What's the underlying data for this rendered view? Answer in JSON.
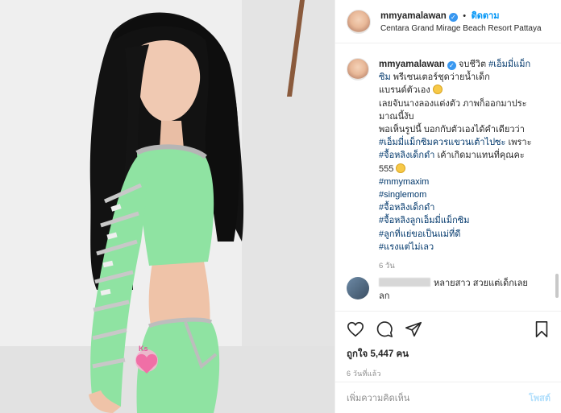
{
  "header": {
    "username": "mmyamalawan",
    "verified_icon": "verified-badge-icon",
    "separator": "•",
    "follow_label": "ติดตาม",
    "location": "Centara Grand Mirage Beach Resort Pattaya"
  },
  "caption": {
    "username": "mmyamalawan",
    "lines": [
      {
        "parts": [
          {
            "t": "text",
            "v": "จบชีวิต "
          },
          {
            "t": "tag",
            "v": "#เอ็มมี่แม็ก"
          }
        ]
      },
      {
        "parts": [
          {
            "t": "tag",
            "v": "ซิม"
          },
          {
            "t": "text",
            "v": " พรีเซนเตอร์ชุดว่ายน้ำเด็ก"
          }
        ]
      },
      {
        "parts": [
          {
            "t": "text",
            "v": "แบรนด์ตัวเอง "
          },
          {
            "t": "emoji",
            "v": "grin-emoji"
          }
        ]
      },
      {
        "parts": [
          {
            "t": "text",
            "v": "เลยจับนางลองแต่งตัว ภาพก็ออกมาประ"
          }
        ]
      },
      {
        "parts": [
          {
            "t": "text",
            "v": "มาณนี้งับ"
          }
        ]
      },
      {
        "parts": [
          {
            "t": "text",
            "v": "พอเห็นรูปนี้ บอกกับตัวเองได้คำเดียวว่า"
          }
        ]
      },
      {
        "parts": [
          {
            "t": "tag",
            "v": "#เอ็มมี่แม็กซิมควรแขวนเต้าไปซะ"
          },
          {
            "t": "text",
            "v": " เพราะ"
          }
        ]
      },
      {
        "parts": [
          {
            "t": "tag",
            "v": "#จื้อหลิงเด็กดำ"
          },
          {
            "t": "text",
            "v": " เค้าเกิดมาแทนที่คุณคะ"
          }
        ]
      },
      {
        "parts": [
          {
            "t": "text",
            "v": "555 "
          },
          {
            "t": "emoji",
            "v": "grin-emoji"
          }
        ]
      },
      {
        "parts": [
          {
            "t": "tag",
            "v": "#mmymaxim"
          }
        ]
      },
      {
        "parts": [
          {
            "t": "tag",
            "v": "#singlemom"
          }
        ]
      },
      {
        "parts": [
          {
            "t": "tag",
            "v": "#จื้อหลิงเด็กดำ"
          }
        ]
      },
      {
        "parts": [
          {
            "t": "tag",
            "v": "#จื้อหลิงลูกเอ็มมี่แม็กซิม"
          }
        ]
      },
      {
        "parts": [
          {
            "t": "tag",
            "v": "#ลูกที่แย่ขอเป็นแม่ที่ดี"
          }
        ]
      },
      {
        "parts": [
          {
            "t": "tag",
            "v": "#แรงแต่ไม่เลว"
          }
        ]
      }
    ],
    "time": "6 วัน"
  },
  "comment": {
    "text_line1": "หลายสาว สวยแต่เด็กเลย",
    "text_line2": "ลก"
  },
  "actions": {
    "like_icon": "heart-icon",
    "comment_icon": "comment-icon",
    "share_icon": "share-icon",
    "save_icon": "bookmark-icon",
    "likes_text": "ถูกใจ 5,447 คน",
    "post_time": "6 วันที่แล้ว"
  },
  "add_comment": {
    "placeholder": "เพิ่มความคิดเห็น",
    "post_label": "โพสต์"
  },
  "photo": {
    "sticker_text": "Ks"
  },
  "colors": {
    "link": "#00376b",
    "accent": "#0095f6",
    "muted": "#8e8e8e",
    "swimsuit": "#8fe3a2"
  }
}
